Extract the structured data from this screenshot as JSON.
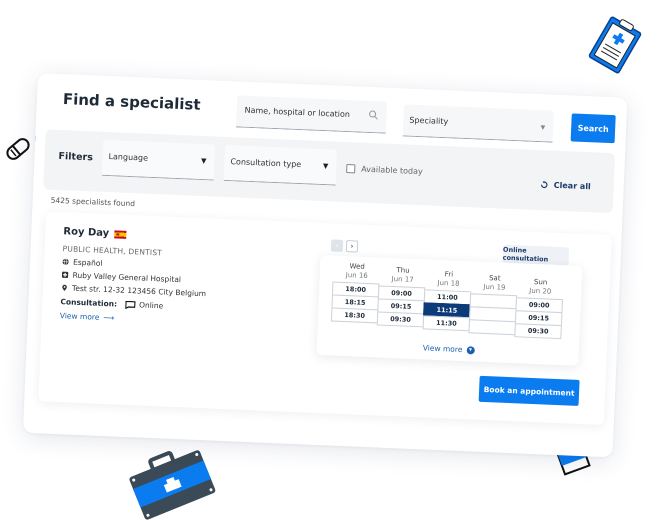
{
  "header": {
    "title": "Find a specialist",
    "search_placeholder": "Name, hospital or location",
    "speciality_placeholder": "Speciality",
    "search_button": "Search"
  },
  "filters": {
    "label": "Filters",
    "language": "Language",
    "consultation_type": "Consultation type",
    "available_today": "Available today",
    "available_today_checked": false,
    "clear_all": "Clear all"
  },
  "results": {
    "count_text": "5425 specialists found"
  },
  "doctor": {
    "name": "Roy Day",
    "flag": "spain-flag",
    "specialties": "PUBLIC HEALTH, DENTIST",
    "language": "Español",
    "hospital": "Ruby Valley General Hospital",
    "address": "Test str. 12-32 123456 City Belgium",
    "consultation_label": "Consultation:",
    "consultation_value": "Online",
    "view_more": "View more"
  },
  "schedule": {
    "prev_label": "‹",
    "next_label": "›",
    "tab": "Online consultation",
    "days": [
      {
        "day": "Wed",
        "date": "Jun 16",
        "slots": [
          "18:00",
          "18:15",
          "18:30"
        ]
      },
      {
        "day": "Thu",
        "date": "Jun 17",
        "slots": [
          "09:00",
          "09:15",
          "09:30"
        ]
      },
      {
        "day": "Fri",
        "date": "Jun 18",
        "slots": [
          "11:00",
          "11:15",
          "11:30"
        ]
      },
      {
        "day": "Sat",
        "date": "Jun 19",
        "slots": [
          "",
          "",
          ""
        ]
      },
      {
        "day": "Sun",
        "date": "Jun 20",
        "slots": [
          "09:00",
          "09:15",
          "09:30"
        ]
      }
    ],
    "selected": {
      "day_index": 2,
      "slot_index": 1
    },
    "view_more": "View more"
  },
  "book_button": "Book an appointment",
  "colors": {
    "primary": "#0a7cf0",
    "selected_slot": "#0d3a78",
    "link": "#1b5fb0",
    "text_dark": "#1e2a38"
  },
  "decorations": [
    "pill-icon",
    "blue-pill-icon",
    "clipboard-icon",
    "medical-bag-icon",
    "medicine-bottle-icon"
  ]
}
